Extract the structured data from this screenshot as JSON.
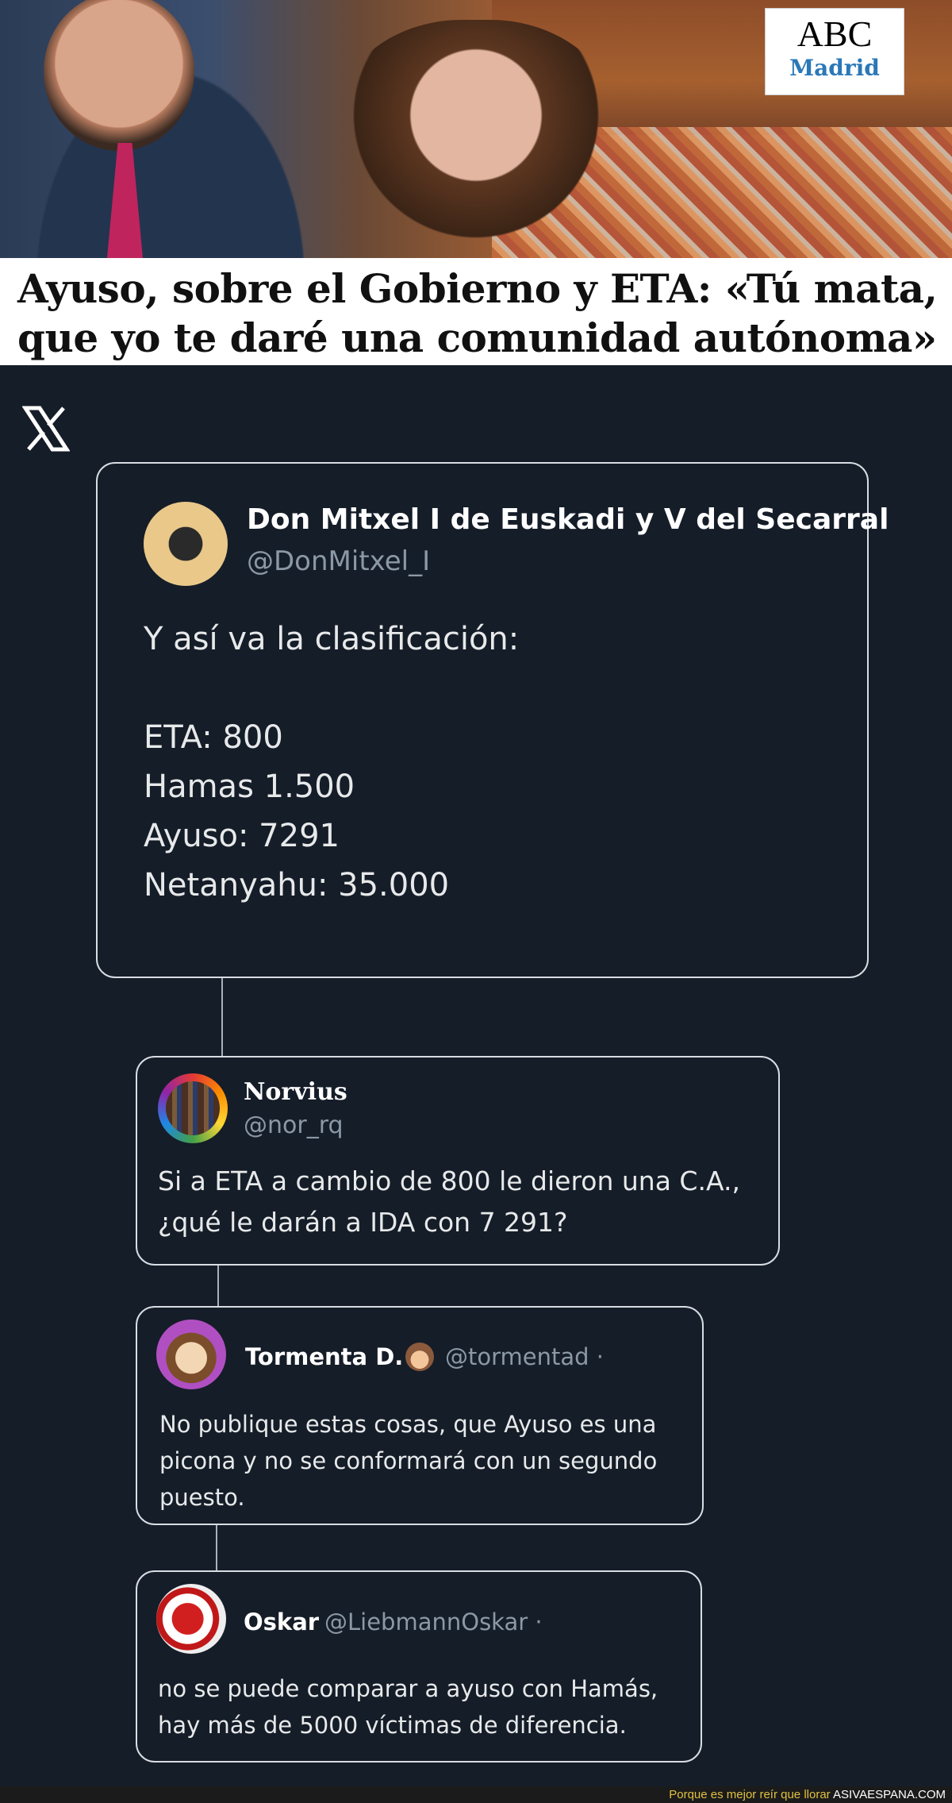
{
  "news": {
    "logo_line1": "ABC",
    "logo_line2": "Madrid",
    "headline": "Ayuso, sobre el Gobierno y ETA: «Tú mata, que yo te daré una comunidad autónoma»"
  },
  "platform_icon": "x-logo-icon",
  "tweets": {
    "main": {
      "name": "Don Mitxel I de Euskadi y V del Secarral",
      "handle": "@DonMitxel_I",
      "text": "Y así va la clasificación:\n\nETA: 800\nHamas 1.500\nAyuso: 7291\nNetanyahu: 35.000"
    },
    "reply1": {
      "name": "Norvius",
      "handle": "@nor_rq",
      "text": "Si a ETA a cambio de 800 le dieron una C.A.,\n¿qué le darán a IDA con 7 291?"
    },
    "reply2": {
      "name": "Tormenta D.",
      "handle": "@tormentad ·",
      "text": "No publique estas cosas, que Ayuso es una\npicona y no se conformará con un segundo\npuesto."
    },
    "reply3": {
      "name": "Oskar",
      "handle": "@LiebmannOskar ·",
      "text": "no se puede comparar a ayuso con Hamás,\nhay más de 5000 víctimas de diferencia."
    }
  },
  "footer": {
    "tagline": "Porque es mejor reír que llorar",
    "site": "ASIVAESPANA.COM"
  }
}
